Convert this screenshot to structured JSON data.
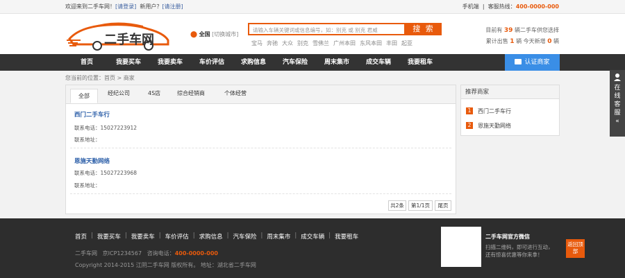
{
  "topbar": {
    "welcome": "欢迎来到二手车网！",
    "login": "[请登录]",
    "new_user": "新用户？",
    "register": "[请注册]",
    "mobile": "手机端",
    "sep": "|",
    "hotline_label": "客服热线：",
    "hotline": "400-0000-000"
  },
  "header": {
    "logo_text": "二手车网",
    "city": "全国",
    "switch_city": "[切换城市]",
    "search_placeholder": "请输入车辆关键词或信息编号，如：别克 或 别克 君威",
    "search_button": "搜 索",
    "hot_words": [
      "宝马",
      "奔驰",
      "大众",
      "别克",
      "雪佛兰",
      "广州本田",
      "东风本田",
      "丰田",
      "起亚"
    ],
    "stats": {
      "line1_pre": "目前有",
      "line1_num": "39",
      "line1_post": "辆二手车供您选择",
      "line2_pre": "累计出售",
      "line2_num": "1",
      "line2_mid": "辆 今天新增",
      "line2_num2": "0",
      "line2_post": "辆"
    }
  },
  "nav": {
    "items": [
      "首页",
      "我要买车",
      "我要卖车",
      "车价评估",
      "求购信息",
      "汽车保险",
      "周末集市",
      "成交车辆",
      "我要租车"
    ],
    "certify": "认证商家"
  },
  "breadcrumb": "您当前的位置：首页 > 商家",
  "tabs": [
    "全部",
    "经纪公司",
    "4S店",
    "综合经销商",
    "个体经营"
  ],
  "dealers": [
    {
      "name": "西门二手车行",
      "phone": "联系电话：15027223912",
      "address": "联系地址："
    },
    {
      "name": "恩施天勤网络",
      "phone": "联系电话：15027223968",
      "address": "联系地址："
    }
  ],
  "pager": {
    "total": "共2条",
    "page": "第1/1页",
    "last": "尾页"
  },
  "sidebar": {
    "title": "推荐商家",
    "items": [
      {
        "rank": "1",
        "name": "西门二手车行"
      },
      {
        "rank": "2",
        "name": "恩施天勤网络"
      }
    ]
  },
  "float_service": [
    "在",
    "线",
    "客",
    "服",
    "«"
  ],
  "footer": {
    "nav": [
      "首页",
      "我要买车",
      "我要卖车",
      "车价评估",
      "求购信息",
      "汽车保险",
      "周末集市",
      "成交车辆",
      "我要租车"
    ],
    "site": "二手车网",
    "icp": "京ICP1234567",
    "phone_label": "咨询电话：",
    "phone": "400-0000-000",
    "copyright": "Copyright 2014-2015 江阴二手车网 版权所有。  地址：湖北省二手车网",
    "wechat_title": "二手车网官方微信",
    "wechat_text": "扫描二维码，即可进行互动，还有惊喜优惠等你来拿！",
    "back_top": "返回顶部"
  },
  "colors": {
    "accent": "#e85a0c",
    "nav_bg": "#333333",
    "certify_bg": "#3a8ee6",
    "link": "#2b5ea8"
  }
}
